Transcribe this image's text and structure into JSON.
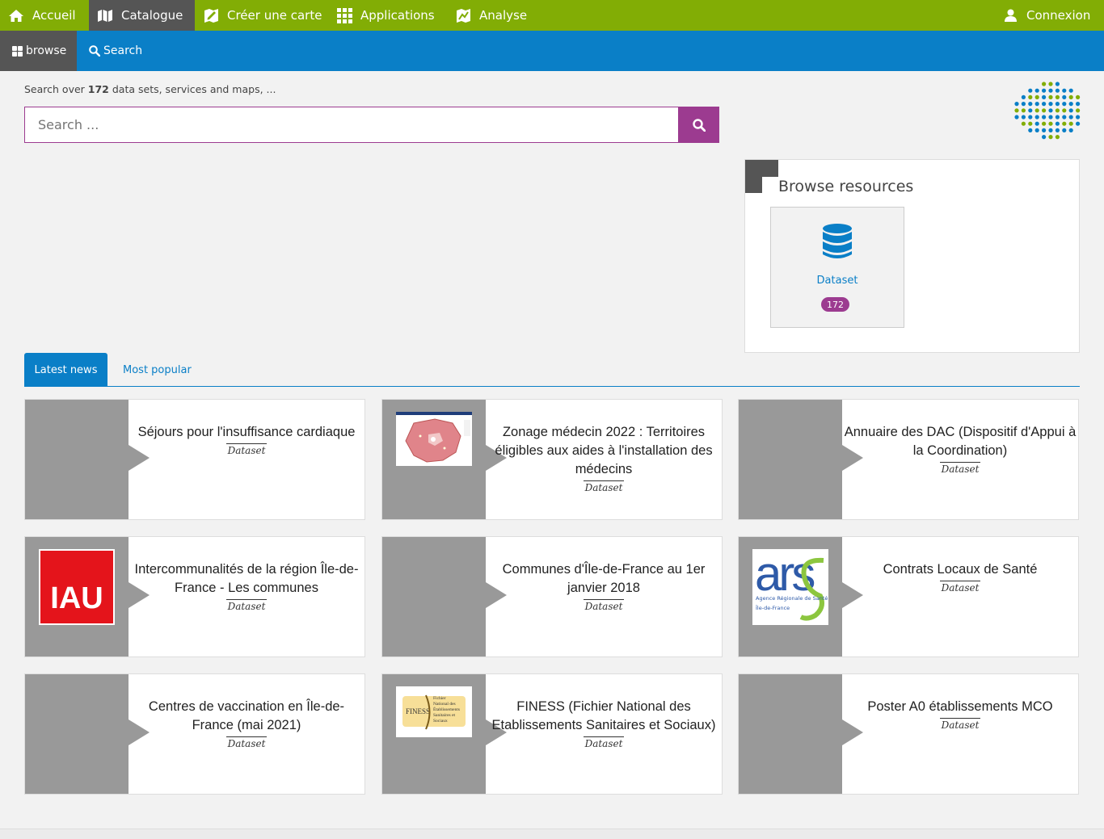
{
  "topnav": {
    "accueil": "Accueil",
    "catalogue": "Catalogue",
    "creer_carte": "Créer une carte",
    "applications": "Applications",
    "analyse": "Analyse",
    "connexion": "Connexion"
  },
  "subnav": {
    "browse": "browse",
    "search": "Search"
  },
  "search": {
    "prefix": "Search over",
    "count": "172",
    "suffix": "data sets, services and maps, ...",
    "placeholder": "Search ..."
  },
  "browse_panel": {
    "title": "Browse resources",
    "tile_label": "Dataset",
    "tile_count": "172"
  },
  "tabs": {
    "latest": "Latest news",
    "popular": "Most popular"
  },
  "cards": [
    {
      "title": "Séjours pour l'insuffisance cardiaque",
      "type": "Dataset",
      "thumb": "none"
    },
    {
      "title": "Zonage médecin 2022 : Territoires éligibles aux aides à l'installation des médecins",
      "type": "Dataset",
      "thumb": "map"
    },
    {
      "title": "Annuaire des DAC (Dispositif d'Appui à la Coordination)",
      "type": "Dataset",
      "thumb": "none"
    },
    {
      "title": "Intercommunalités de la région Île-de-France - Les communes",
      "type": "Dataset",
      "thumb": "iau"
    },
    {
      "title": "Communes d'Île-de-France au 1er janvier 2018",
      "type": "Dataset",
      "thumb": "none"
    },
    {
      "title": "Contrats Locaux de Santé",
      "type": "Dataset",
      "thumb": "ars"
    },
    {
      "title": "Centres de vaccination en Île-de-France (mai 2021)",
      "type": "Dataset",
      "thumb": "none"
    },
    {
      "title": "FINESS (Fichier National des Etablissements Sanitaires et Sociaux)",
      "type": "Dataset",
      "thumb": "finess"
    },
    {
      "title": "Poster A0 établissements MCO",
      "type": "Dataset",
      "thumb": "none"
    }
  ],
  "thumb_text": {
    "iau": "IAU",
    "ars_logo": "ars",
    "ars_line1": "Agence Régionale de Santé",
    "ars_line2": "Île-de-France",
    "finess_logo": "FINESS",
    "finess_desc": "Fichier National des Établissements Sanitaires et Sociaux"
  },
  "colors": {
    "topnav": "#82ad05",
    "subnav": "#0a7fc7",
    "accent": "#9c3b90",
    "active_nav": "#555555",
    "thumb_gray": "#999999"
  },
  "icons": {
    "accueil": "home-icon",
    "catalogue": "map-icon",
    "creer_carte": "map-edit-icon",
    "applications": "grid-icon",
    "analyse": "chart-map-icon",
    "connexion": "user-icon",
    "browse": "th-large-icon",
    "search": "search-icon",
    "dataset": "database-icon"
  }
}
